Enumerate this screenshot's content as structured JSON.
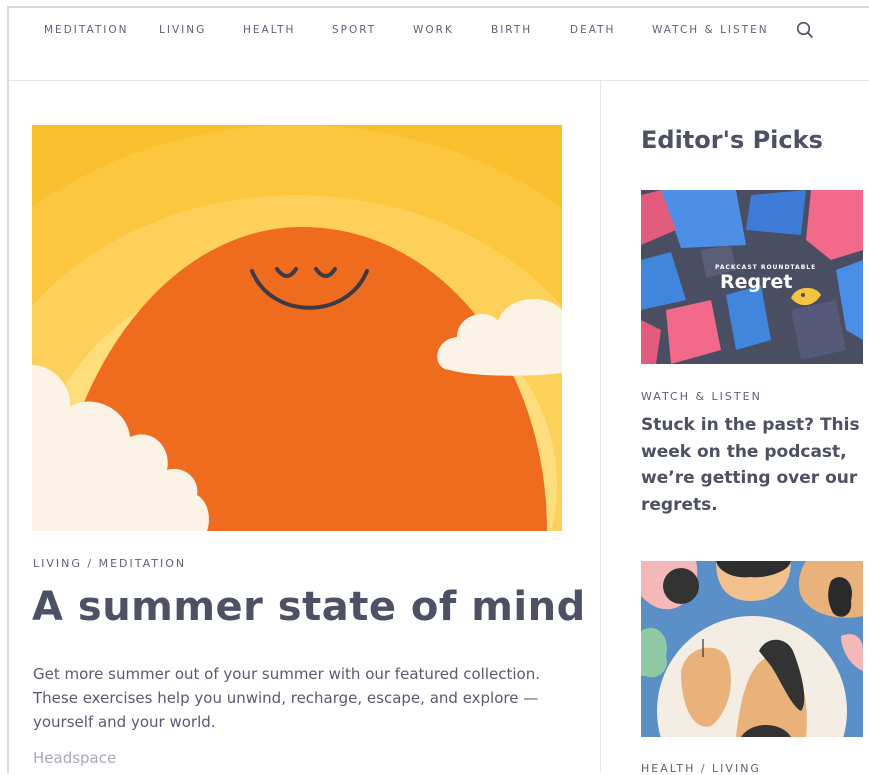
{
  "nav": {
    "items": [
      "MEDITATION",
      "LIVING",
      "HEALTH",
      "SPORT",
      "WORK",
      "BIRTH",
      "DEATH",
      "WATCH & LISTEN"
    ],
    "search_icon": "search-icon"
  },
  "hero": {
    "category": "LIVING / MEDITATION",
    "title": "A summer state of mind",
    "description": "Get more summer out of your summer with our featured collection. These exercises help you unwind, recharge, escape, and explore — yourself and your world.",
    "author": "Headspace"
  },
  "sidebar": {
    "title": "Editor's Picks",
    "picks": [
      {
        "image_kicker": "PACKCAST ROUNDTABLE",
        "image_title": "Regret",
        "category": "WATCH & LISTEN",
        "headline": "Stuck in the past? This week on the podcast, we’re getting over our regrets."
      },
      {
        "category": "HEALTH / LIVING"
      }
    ]
  },
  "colors": {
    "sun_orange": "#ef6c1f",
    "sky_yellow": "#fbc02d",
    "text_dark": "#4e5165",
    "text_muted": "#a7a9b3"
  }
}
